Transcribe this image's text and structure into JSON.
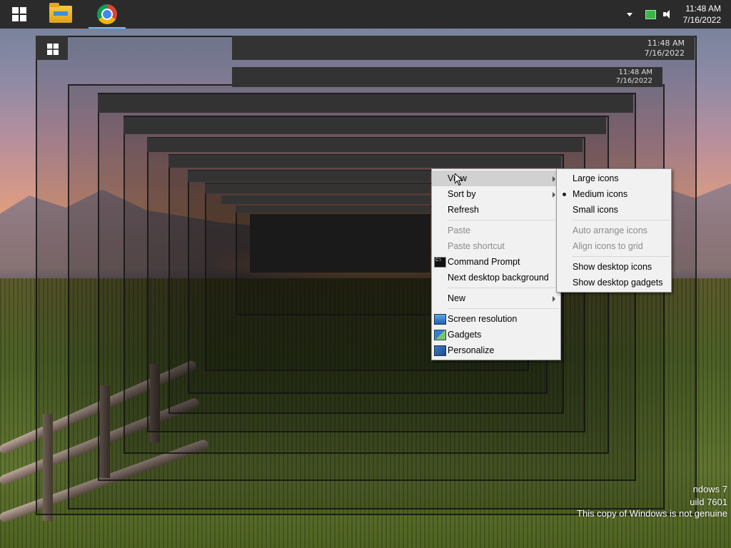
{
  "taskbar": {
    "clock_time": "11:48 AM",
    "clock_date": "7/16/2022",
    "items": [
      {
        "name": "start",
        "icon": "windows-icon"
      },
      {
        "name": "file-explorer",
        "icon": "folder-icon"
      },
      {
        "name": "chrome",
        "icon": "chrome-icon"
      }
    ]
  },
  "desktop": {
    "mini_clock_time": "11:48 AM",
    "mini_clock_date": "7/16/2022",
    "watermark": {
      "line1": "ndows 7",
      "line2": "uild 7601",
      "line3": "This copy of Windows is not genuine"
    }
  },
  "context_menu": {
    "items": [
      {
        "label": "View",
        "submenu": true,
        "highlight": true
      },
      {
        "label": "Sort by",
        "submenu": true
      },
      {
        "label": "Refresh"
      },
      {
        "sep": true
      },
      {
        "label": "Paste",
        "disabled": true
      },
      {
        "label": "Paste shortcut",
        "disabled": true
      },
      {
        "label": "Command Prompt",
        "icon": "cmd-icon"
      },
      {
        "label": "Next desktop background"
      },
      {
        "sep": true
      },
      {
        "label": "New",
        "submenu": true
      },
      {
        "sep": true
      },
      {
        "label": "Screen resolution",
        "icon": "screen-icon"
      },
      {
        "label": "Gadgets",
        "icon": "gadget-icon"
      },
      {
        "label": "Personalize",
        "icon": "person-icon"
      }
    ]
  },
  "view_submenu": {
    "items": [
      {
        "label": "Large icons"
      },
      {
        "label": "Medium icons",
        "selected": true
      },
      {
        "label": "Small icons"
      },
      {
        "sep": true
      },
      {
        "label": "Auto arrange icons",
        "disabled": true
      },
      {
        "label": "Align icons to grid",
        "disabled": true
      },
      {
        "sep": true
      },
      {
        "label": "Show desktop icons"
      },
      {
        "label": "Show desktop gadgets"
      }
    ]
  },
  "colors": {
    "taskbar_bg": "#2b2b2b",
    "accent": "#76b9ed",
    "menu_bg": "#f1f1f1",
    "menu_highlight": "#d1d1d1",
    "disabled_text": "#8b8b8b"
  }
}
